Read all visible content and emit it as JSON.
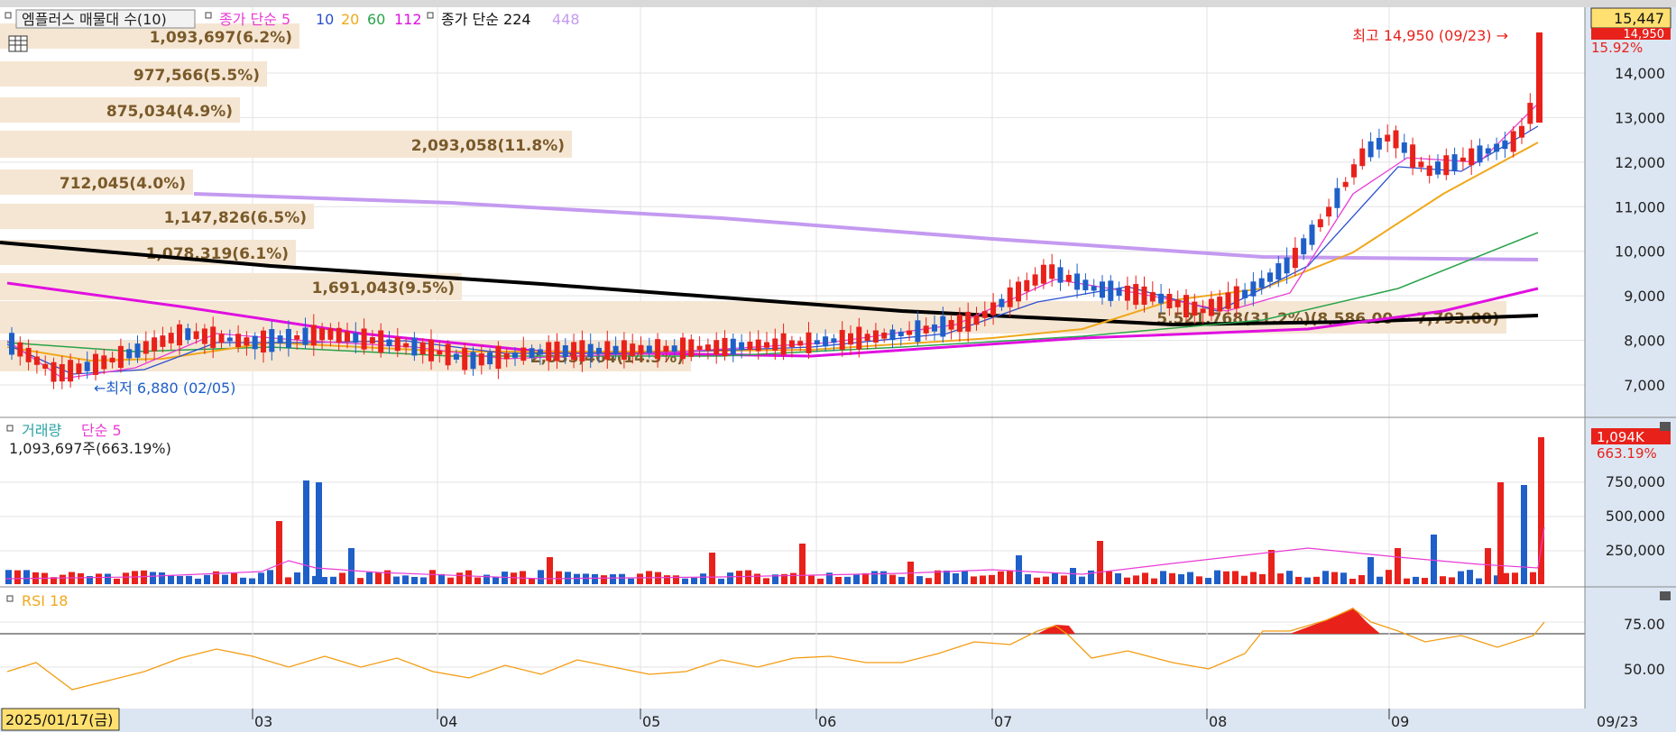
{
  "price_panel": {
    "title_box": "엠플러스 매물대 수(10)",
    "legend_ma_label": "종가 단순 5",
    "legend_ma_periods": [
      "10",
      "20",
      "60",
      "112"
    ],
    "legend_ma2_label": "종가 단순 224",
    "legend_ma2_period": "448",
    "high_annotation": "최고 14,950 (09/23) →",
    "low_annotation": "←최저 6,880 (02/05)",
    "current_badge": "15,447",
    "current_pct": "15.92%",
    "prev_badge": "14,950",
    "y_ticks": [
      "14,000",
      "13,000",
      "12,000",
      "11,000",
      "10,000",
      "9,000",
      "8,000",
      "7,000"
    ]
  },
  "volume_profile": [
    {
      "label": "1,093,697(6.2%)"
    },
    {
      "label": "977,566(5.5%)"
    },
    {
      "label": "875,034(4.9%)"
    },
    {
      "label": "2,093,058(11.8%)"
    },
    {
      "label": "712,045(4.0%)"
    },
    {
      "label": "1,147,826(6.5%)"
    },
    {
      "label": "1,078,319(6.1%)"
    },
    {
      "label": "1,691,043(9.5%)"
    },
    {
      "label": "5,521,768(31.2%)(8,586.00 ~ 7,793.00)"
    },
    {
      "label": "2,535,464(14.3%)"
    }
  ],
  "volume_panel": {
    "title": "거래량",
    "ma_label": "단순 5",
    "info": "1,093,697주(663.19%)",
    "badge": "1,094K",
    "badge_pct": "663.19%",
    "y_ticks": [
      "750,000",
      "500,000",
      "250,000"
    ]
  },
  "rsi_panel": {
    "title": "RSI 18",
    "y_ticks": [
      "75.00",
      "50.00"
    ]
  },
  "x_axis": {
    "start_date": "2025/01/17(금)",
    "months": [
      "03",
      "04",
      "05",
      "06",
      "07",
      "08",
      "09"
    ],
    "end_label": "09/23"
  },
  "colors": {
    "up": "#e8211b",
    "down": "#1f5fc8",
    "ma5": "#e83bd6",
    "ma10": "#2a4fd1",
    "ma20": "#f0a81c",
    "ma60": "#2aa34a",
    "ma112": "#e010e0",
    "ma224": "#000000",
    "ma448": "#c49af0",
    "profile": "#f5e6d3",
    "rsi": "#f39c12"
  }
}
